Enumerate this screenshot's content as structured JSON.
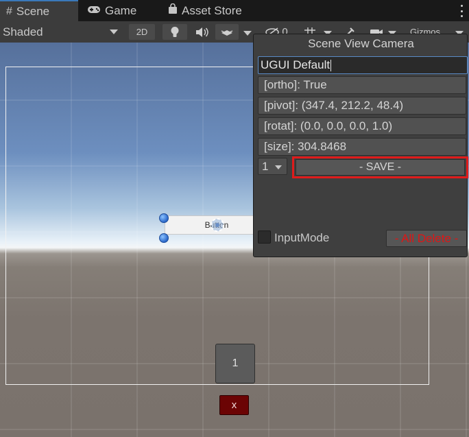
{
  "tabs": [
    {
      "label": "Scene",
      "icon": "grid-icon",
      "active": true
    },
    {
      "label": "Game",
      "icon": "gamepad-icon"
    },
    {
      "label": "Asset Store",
      "icon": "shopping-bag-icon"
    }
  ],
  "toolbar": {
    "shading_mode": "Shaded",
    "mode_2d_label": "2D",
    "hidden_count": "0",
    "gizmos_label": "Gizmos"
  },
  "scene": {
    "ui_button_label": "Button",
    "number_tile_label": "1",
    "close_button_label": "x"
  },
  "camera_panel": {
    "title": "Scene View Camera",
    "name_value": "UGUI Default",
    "ortho": "[ortho]: True",
    "pivot": "[pivot]: (347.4, 212.2, 48.4)",
    "rotat": "[rotat]: (0.0, 0.0, 0.0, 1.0)",
    "size": "[size]: 304.8468",
    "slot_value": "1",
    "save_label": "- SAVE -",
    "input_mode_label": "InputMode",
    "delete_label": "- All Delete -"
  },
  "colors": {
    "accent_highlight": "#e01b1b",
    "delete_text": "#e01515",
    "close_button_bg": "#6b0404"
  }
}
